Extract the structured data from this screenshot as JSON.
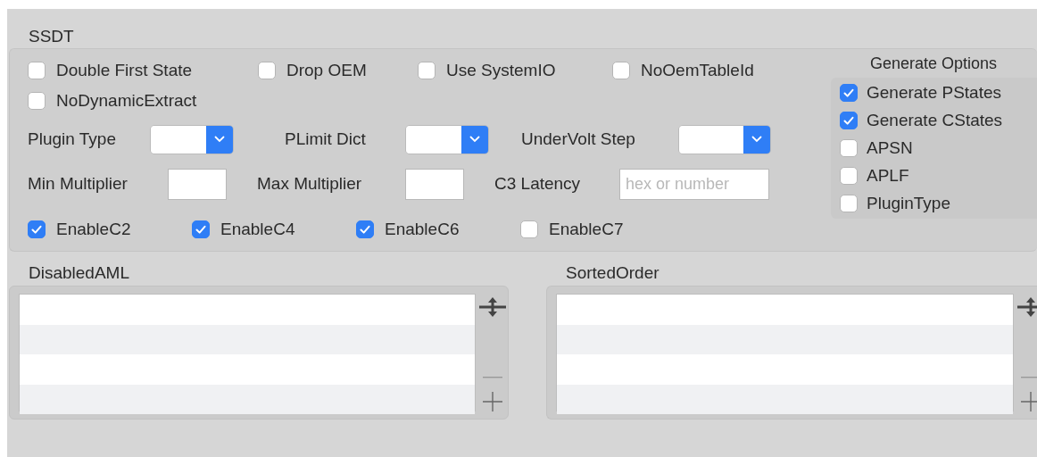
{
  "ssdt": {
    "title": "SSDT",
    "options": [
      {
        "label": "Double First State",
        "checked": false
      },
      {
        "label": "Drop OEM",
        "checked": false
      },
      {
        "label": "Use SystemIO",
        "checked": false
      },
      {
        "label": "NoOemTableId",
        "checked": false
      },
      {
        "label": "NoDynamicExtract",
        "checked": false
      }
    ],
    "dropdowns": [
      {
        "label": "Plugin Type"
      },
      {
        "label": "PLimit Dict"
      },
      {
        "label": "UnderVolt Step"
      }
    ],
    "fields": [
      {
        "label": "Min Multiplier"
      },
      {
        "label": "Max Multiplier"
      },
      {
        "label": "C3 Latency",
        "placeholder": "hex or number"
      }
    ],
    "c_states": [
      {
        "label": "EnableC2",
        "checked": true
      },
      {
        "label": "EnableC4",
        "checked": true
      },
      {
        "label": "EnableC6",
        "checked": true
      },
      {
        "label": "EnableC7",
        "checked": false
      }
    ],
    "generate_options": {
      "title": "Generate Options",
      "items": [
        {
          "label": "Generate PStates",
          "checked": true
        },
        {
          "label": "Generate CStates",
          "checked": true
        },
        {
          "label": "APSN",
          "checked": false
        },
        {
          "label": "APLF",
          "checked": false
        },
        {
          "label": "PluginType",
          "checked": false
        }
      ]
    }
  },
  "lists": [
    {
      "title": "DisabledAML"
    },
    {
      "title": "SortedOrder"
    }
  ]
}
